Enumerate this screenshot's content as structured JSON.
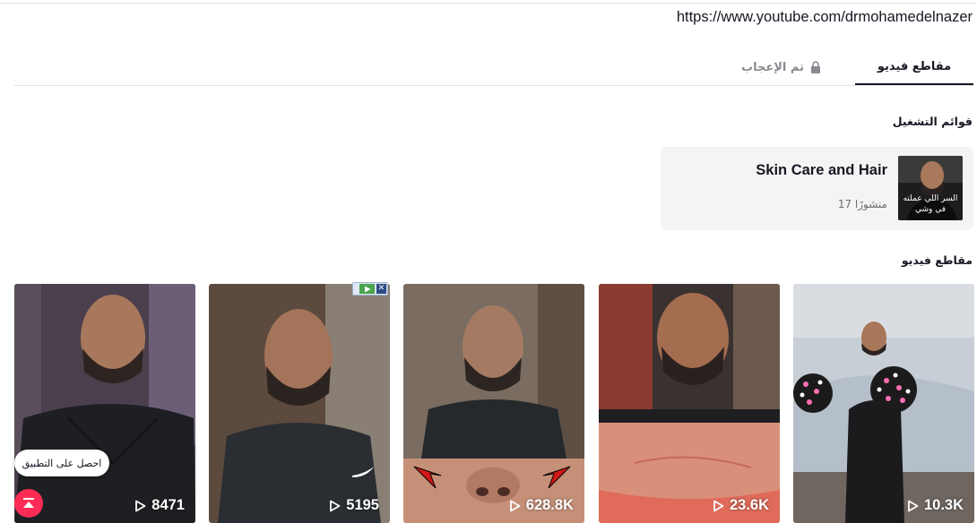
{
  "url": "https://www.youtube.com/drmohamedelnazer",
  "tabs": {
    "videos": "مقاطع فيديو",
    "liked": "تم الإعجاب"
  },
  "sections": {
    "playlists": "قوائم التشغيل",
    "videos": "مقاطع فيديو"
  },
  "playlist": {
    "title": "Skin Care and Hair",
    "count": "17 منشورًا",
    "thumb_caption": "السر اللي عملته في وشي"
  },
  "videos": [
    {
      "views": "10.3K"
    },
    {
      "views": "23.6K"
    },
    {
      "views": "628.8K"
    },
    {
      "views": "5195"
    },
    {
      "views": "8471"
    }
  ],
  "app_button": "احصل على التطبيق",
  "colors": {
    "accent": "#fe2c55",
    "text": "#161823",
    "muted": "#8a8b91"
  }
}
